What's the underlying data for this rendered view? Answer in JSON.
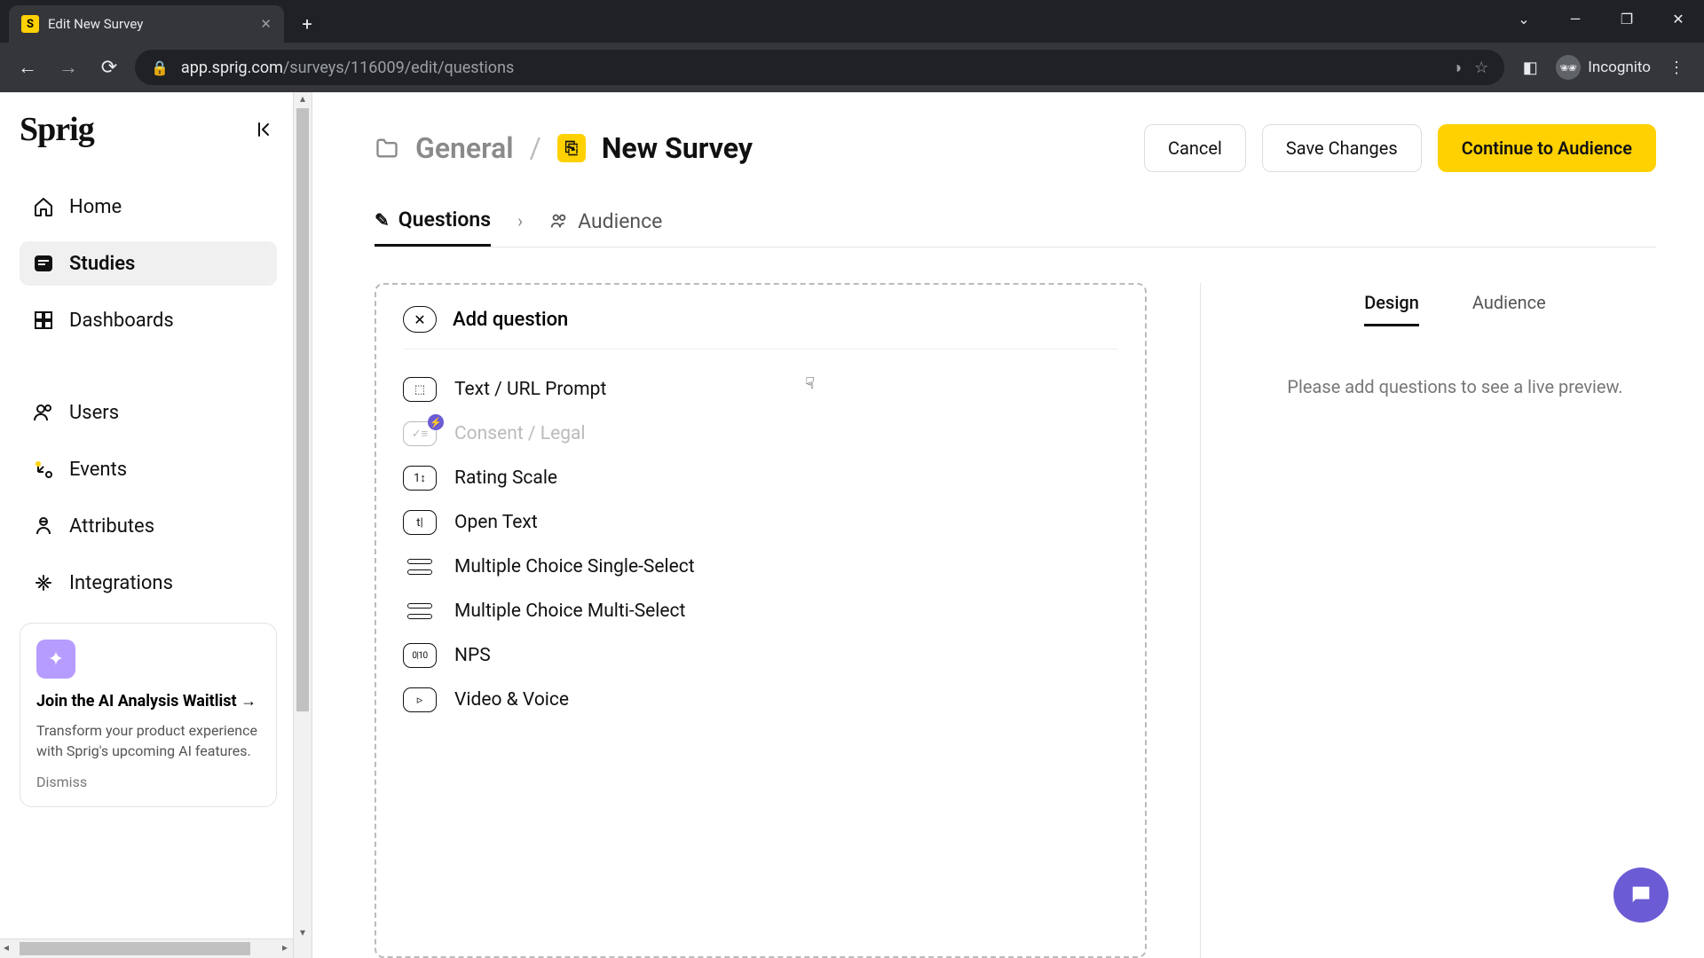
{
  "browser": {
    "tab_title": "Edit New Survey",
    "url_domain": "app.sprig.com",
    "url_path": "/surveys/116009/edit/questions",
    "incognito_label": "Incognito"
  },
  "sidebar": {
    "brand": "Sprig",
    "items": [
      {
        "label": "Home"
      },
      {
        "label": "Studies"
      },
      {
        "label": "Dashboards"
      },
      {
        "label": "Users"
      },
      {
        "label": "Events"
      },
      {
        "label": "Attributes"
      },
      {
        "label": "Integrations"
      }
    ],
    "ai_card": {
      "title": "Join the AI Analysis Waitlist →",
      "body": "Transform your product experience with Sprig's upcoming AI features.",
      "dismiss": "Dismiss"
    }
  },
  "header": {
    "folder": "General",
    "title": "New Survey",
    "cancel": "Cancel",
    "save": "Save Changes",
    "continue": "Continue to Audience"
  },
  "steps": {
    "questions": "Questions",
    "audience": "Audience"
  },
  "add_question": {
    "title": "Add question",
    "types": [
      {
        "label": "Text / URL Prompt"
      },
      {
        "label": "Consent / Legal"
      },
      {
        "label": "Rating Scale"
      },
      {
        "label": "Open Text"
      },
      {
        "label": "Multiple Choice Single-Select"
      },
      {
        "label": "Multiple Choice Multi-Select"
      },
      {
        "label": "NPS"
      },
      {
        "label": "Video & Voice"
      }
    ]
  },
  "right_panel": {
    "tabs": {
      "design": "Design",
      "audience": "Audience"
    },
    "placeholder": "Please add questions to see a live preview."
  }
}
